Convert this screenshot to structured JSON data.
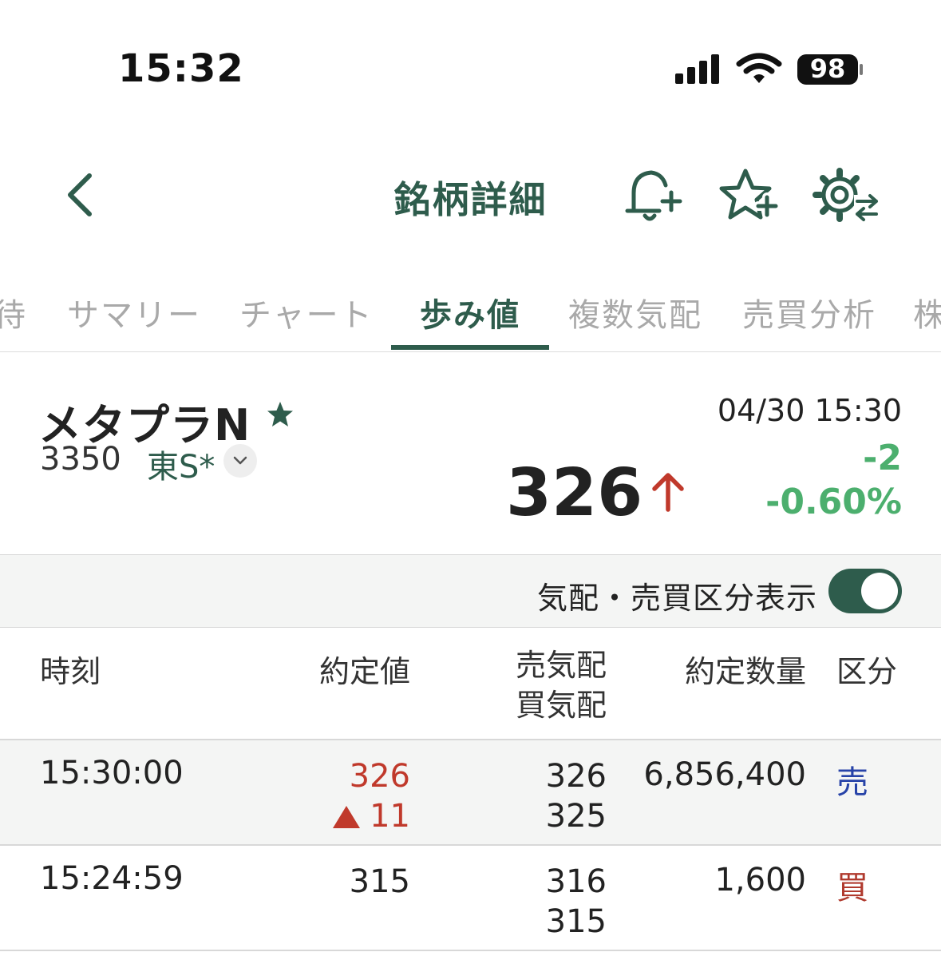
{
  "status_bar": {
    "time": "15:32",
    "battery": "98",
    "icons": [
      "signal-icon",
      "wifi-icon",
      "battery-icon"
    ]
  },
  "header": {
    "title": "銘柄詳細",
    "icons": [
      "back-chevron-icon",
      "bell-plus-icon",
      "star-plus-icon",
      "gear-swap-icon"
    ]
  },
  "tabs": [
    {
      "label": "待"
    },
    {
      "label": "サマリー"
    },
    {
      "label": "チャート"
    },
    {
      "label": "歩み値",
      "active": true
    },
    {
      "label": "複数気配"
    },
    {
      "label": "売買分析"
    },
    {
      "label": "株"
    }
  ],
  "stock": {
    "name": "メタプラN",
    "code": "3350",
    "market": "東S*",
    "timestamp": "04/30 15:30",
    "price": "326",
    "change": "-2",
    "change_pct": "-0.60%"
  },
  "toggle": {
    "label": "気配・売買区分表示",
    "on": true
  },
  "table": {
    "headers": {
      "time": "時刻",
      "price": "約定値",
      "ask": "売気配",
      "bid": "買気配",
      "qty": "約定数量",
      "side": "区分"
    },
    "rows": [
      {
        "time": "15:30:00",
        "price": "326",
        "price_change": "11",
        "ask": "326",
        "bid": "325",
        "qty": "6,856,400",
        "side": "売"
      },
      {
        "time": "15:24:59",
        "price": "315",
        "ask": "316",
        "bid": "315",
        "qty": "1,600",
        "side": "買"
      }
    ]
  },
  "colors": {
    "brand": "#2e5c4c",
    "down": "#4caf6e",
    "up": "#c0392b",
    "sell": "#2743a8"
  }
}
